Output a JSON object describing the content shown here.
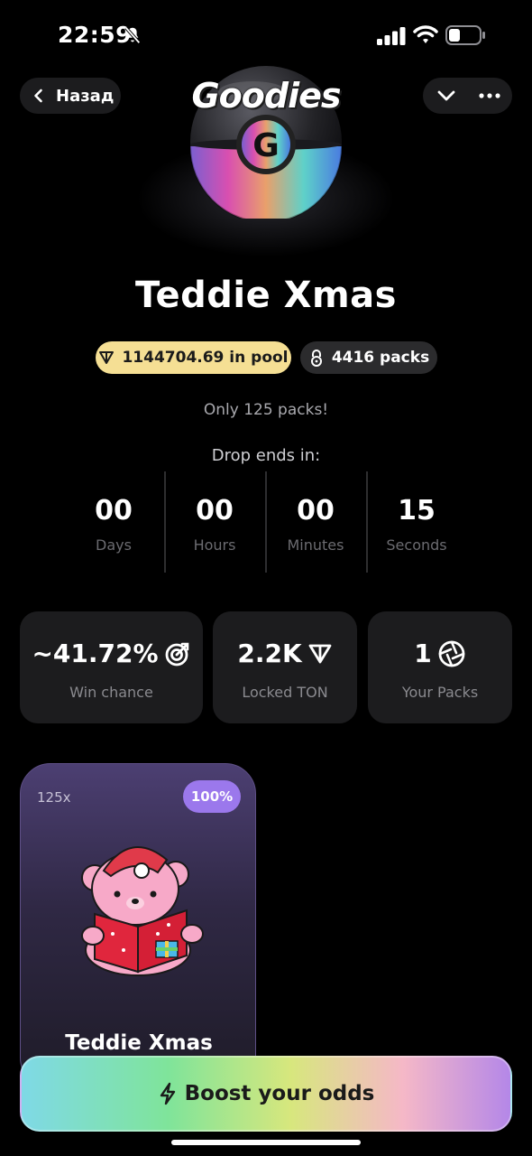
{
  "status_bar": {
    "time": "22:59",
    "icons": [
      "bell-slash-icon",
      "cellular-signal-icon",
      "wifi-icon",
      "battery-icon"
    ]
  },
  "nav": {
    "back_label": "Назад",
    "icons": [
      "chevron-left-icon",
      "chevron-down-icon",
      "more-horizontal-icon"
    ]
  },
  "logo": {
    "text": "Goodies",
    "emblem_letter": "G"
  },
  "drop": {
    "title": "Teddie Xmas",
    "pool_text": "1144704.69 in pool",
    "packs_text": "4416 packs",
    "note": "Only 125 packs!",
    "ends_label": "Drop ends in:"
  },
  "countdown": {
    "days": "00",
    "days_label": "Days",
    "hours": "00",
    "hours_label": "Hours",
    "minutes": "00",
    "minutes_label": "Minutes",
    "seconds": "15",
    "seconds_label": "Seconds"
  },
  "stats": {
    "win_chance": "~41.72%",
    "win_chance_label": "Win chance",
    "locked": "2.2K",
    "locked_label": "Locked TON",
    "your_packs": "1",
    "your_packs_label": "Your Packs"
  },
  "gift": {
    "multiplier": "125x",
    "chance": "100%",
    "name": "Teddie Xmas"
  },
  "boost": {
    "label": "Boost your odds"
  },
  "colors": {
    "background": "#000000",
    "card": "#1c1c1e",
    "pool_badge": "#f5df94",
    "chance_pill": "#9b78ec",
    "gift_card_top": "#4c3f72"
  }
}
